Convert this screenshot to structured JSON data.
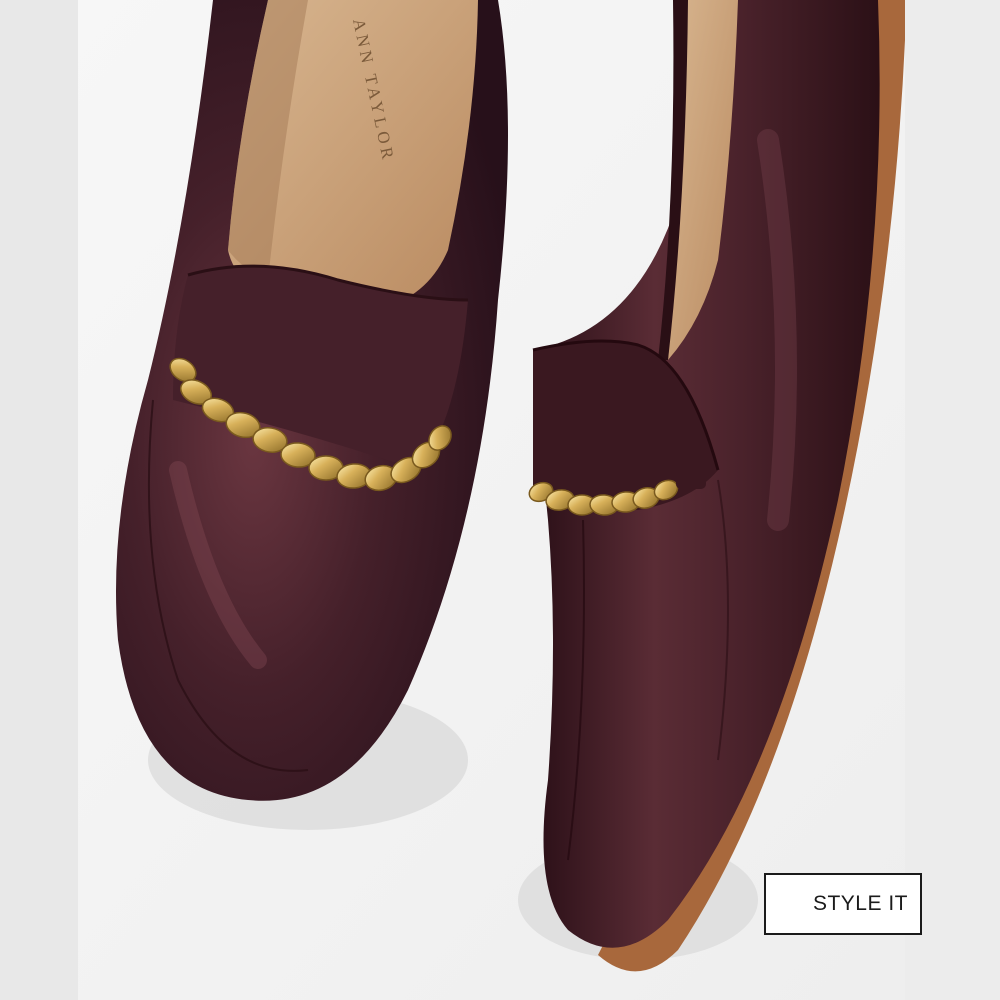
{
  "product_image": {
    "alt": "Burgundy leather loafers with gold chain detail",
    "insole_brand": "ANN TAYLOR",
    "colors": {
      "leather": "#3e1b22",
      "leather_dark": "#2a0f15",
      "leather_light": "#6a3640",
      "insole": "#c9a07a",
      "gold": "#d8b15a",
      "gold_dark": "#8a6a26",
      "sole": "#a8683c",
      "background": "#f4f4f4"
    }
  },
  "actions": {
    "style_it_label": "STYLE IT"
  }
}
